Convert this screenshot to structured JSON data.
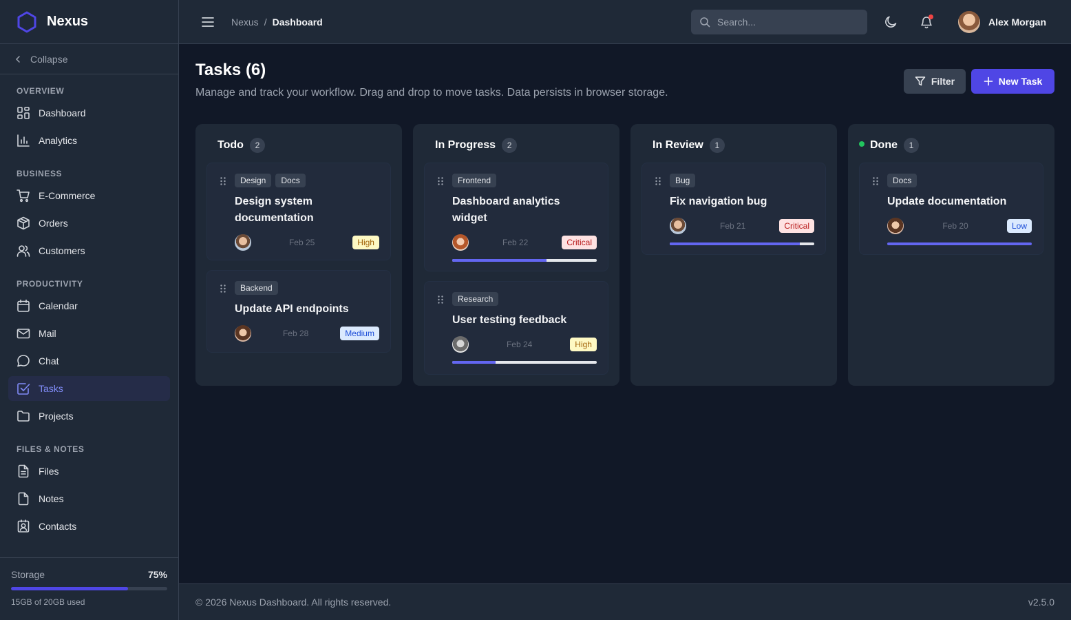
{
  "brand": {
    "name": "Nexus",
    "logo_icon": "hexagon-icon",
    "accent": "#4f46e5"
  },
  "sidebar": {
    "collapse_label": "Collapse",
    "sections": [
      {
        "title": "OVERVIEW",
        "items": [
          {
            "label": "Dashboard",
            "icon": "grid-icon"
          },
          {
            "label": "Analytics",
            "icon": "bar-chart-icon"
          }
        ]
      },
      {
        "title": "BUSINESS",
        "items": [
          {
            "label": "E-Commerce",
            "icon": "cart-icon"
          },
          {
            "label": "Orders",
            "icon": "package-icon"
          },
          {
            "label": "Customers",
            "icon": "users-icon"
          }
        ]
      },
      {
        "title": "PRODUCTIVITY",
        "items": [
          {
            "label": "Calendar",
            "icon": "calendar-icon"
          },
          {
            "label": "Mail",
            "icon": "mail-icon"
          },
          {
            "label": "Chat",
            "icon": "chat-icon"
          },
          {
            "label": "Tasks",
            "icon": "check-square-icon",
            "active": true
          },
          {
            "label": "Projects",
            "icon": "folder-icon"
          }
        ]
      },
      {
        "title": "FILES & NOTES",
        "items": [
          {
            "label": "Files",
            "icon": "file-text-icon"
          },
          {
            "label": "Notes",
            "icon": "file-icon"
          },
          {
            "label": "Contacts",
            "icon": "contact-icon"
          }
        ]
      }
    ],
    "storage": {
      "label": "Storage",
      "percent_label": "75%",
      "percent": 75,
      "used_label": "15GB of 20GB used"
    }
  },
  "topbar": {
    "breadcrumb": {
      "root": "Nexus",
      "separator": "/",
      "current": "Dashboard"
    },
    "search_placeholder": "Search...",
    "user_name": "Alex Morgan",
    "notification_dot_color": "#ef4444"
  },
  "page": {
    "title": "Tasks (6)",
    "description": "Manage and track your workflow. Drag and drop to move tasks. Data persists in browser storage.",
    "filter_label": "Filter",
    "new_task_label": "New Task"
  },
  "columns": [
    {
      "title": "Todo",
      "count": "2",
      "cards": [
        {
          "tags": [
            "Design",
            "Docs"
          ],
          "title": "Design system documentation",
          "avatar": "av-m",
          "date": "Feb 25",
          "priority": "High",
          "priority_class": "prio-high",
          "progress": null
        },
        {
          "tags": [
            "Backend"
          ],
          "title": "Update API endpoints",
          "avatar": "av-f",
          "date": "Feb 28",
          "priority": "Medium",
          "priority_class": "prio-medium",
          "progress": null
        }
      ]
    },
    {
      "title": "In Progress",
      "count": "2",
      "cards": [
        {
          "tags": [
            "Frontend"
          ],
          "title": "Dashboard analytics widget",
          "avatar": "av-r",
          "date": "Feb 22",
          "priority": "Critical",
          "priority_class": "prio-critical",
          "progress": 65
        },
        {
          "tags": [
            "Research"
          ],
          "title": "User testing feedback",
          "avatar": "av-g",
          "date": "Feb 24",
          "priority": "High",
          "priority_class": "prio-high",
          "progress": 30
        }
      ]
    },
    {
      "title": "In Review",
      "count": "1",
      "cards": [
        {
          "tags": [
            "Bug"
          ],
          "title": "Fix navigation bug",
          "avatar": "av-m",
          "date": "Feb 21",
          "priority": "Critical",
          "priority_class": "prio-critical",
          "progress": 90
        }
      ]
    },
    {
      "title": "Done",
      "count": "1",
      "status_dot_color": "#22c55e",
      "cards": [
        {
          "tags": [
            "Docs"
          ],
          "title": "Update documentation",
          "avatar": "av-f",
          "date": "Feb 20",
          "priority": "Low",
          "priority_class": "prio-low",
          "progress": 100
        }
      ]
    }
  ],
  "footer": {
    "copyright": "© 2026 Nexus Dashboard. All rights reserved.",
    "version": "v2.5.0"
  }
}
